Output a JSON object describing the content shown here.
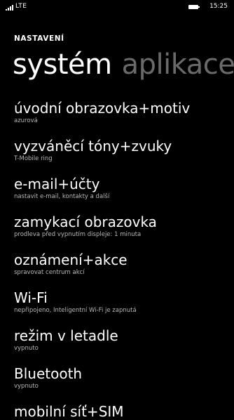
{
  "status": {
    "network": "LTE",
    "time": "15:25",
    "icons": [
      "signal-strength-icon",
      "battery-icon"
    ]
  },
  "header": {
    "section_title": "NASTAVENÍ",
    "pivot_active": "systém",
    "pivot_inactive": "aplikace"
  },
  "settings": [
    {
      "title": "úvodní obrazovka+motiv",
      "subtitle": "azurová"
    },
    {
      "title": "vyzváněcí tóny+zvuky",
      "subtitle": "T-Mobile ring"
    },
    {
      "title": "e-mail+účty",
      "subtitle": "nastavit e-mail, kontakty a další"
    },
    {
      "title": "zamykací obrazovka",
      "subtitle": "prodleva před vypnutím displeje: 1 minuta"
    },
    {
      "title": "oznámení+akce",
      "subtitle": "spravovat centrum akcí"
    },
    {
      "title": "Wi-Fi",
      "subtitle": "nepřipojeno, Inteligentní Wi-Fi je zapnutá"
    },
    {
      "title": "režim v letadle",
      "subtitle": "vypnuto"
    },
    {
      "title": "Bluetooth",
      "subtitle": "vypnuto"
    },
    {
      "title": "mobilní síť+SIM",
      "subtitle": ""
    }
  ]
}
